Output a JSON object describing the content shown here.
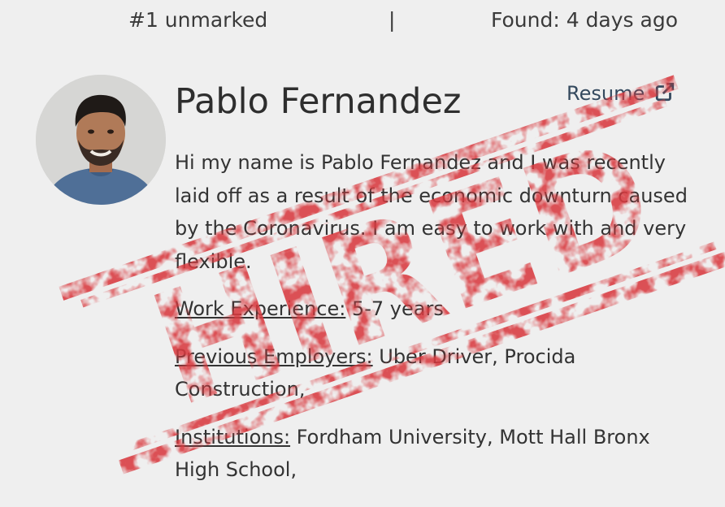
{
  "header": {
    "rank": "#1 unmarked",
    "separator": "|",
    "found": "Found: 4 days ago"
  },
  "candidate": {
    "name": "Pablo Fernandez",
    "resume_label": "Resume",
    "bio": "Hi my name is Pablo Fernandez and I was recently laid off as a result of the economic downturn caused by the Coronavirus. I am easy to work with and very flexible.",
    "work_experience_label": "Work Experience:",
    "work_experience_value": "5-7 years",
    "previous_employers_label": "Previous Employers:",
    "previous_employers_value": "Uber Driver, Procida Construction,",
    "institutions_label": "Institutions:",
    "institutions_value": "Fordham University, Mott Hall Bronx High School,"
  },
  "stamp": {
    "text": "HIRED",
    "color": "#d93a3f"
  },
  "icons": {
    "resume": "external-link-icon",
    "avatar": "profile-photo"
  }
}
